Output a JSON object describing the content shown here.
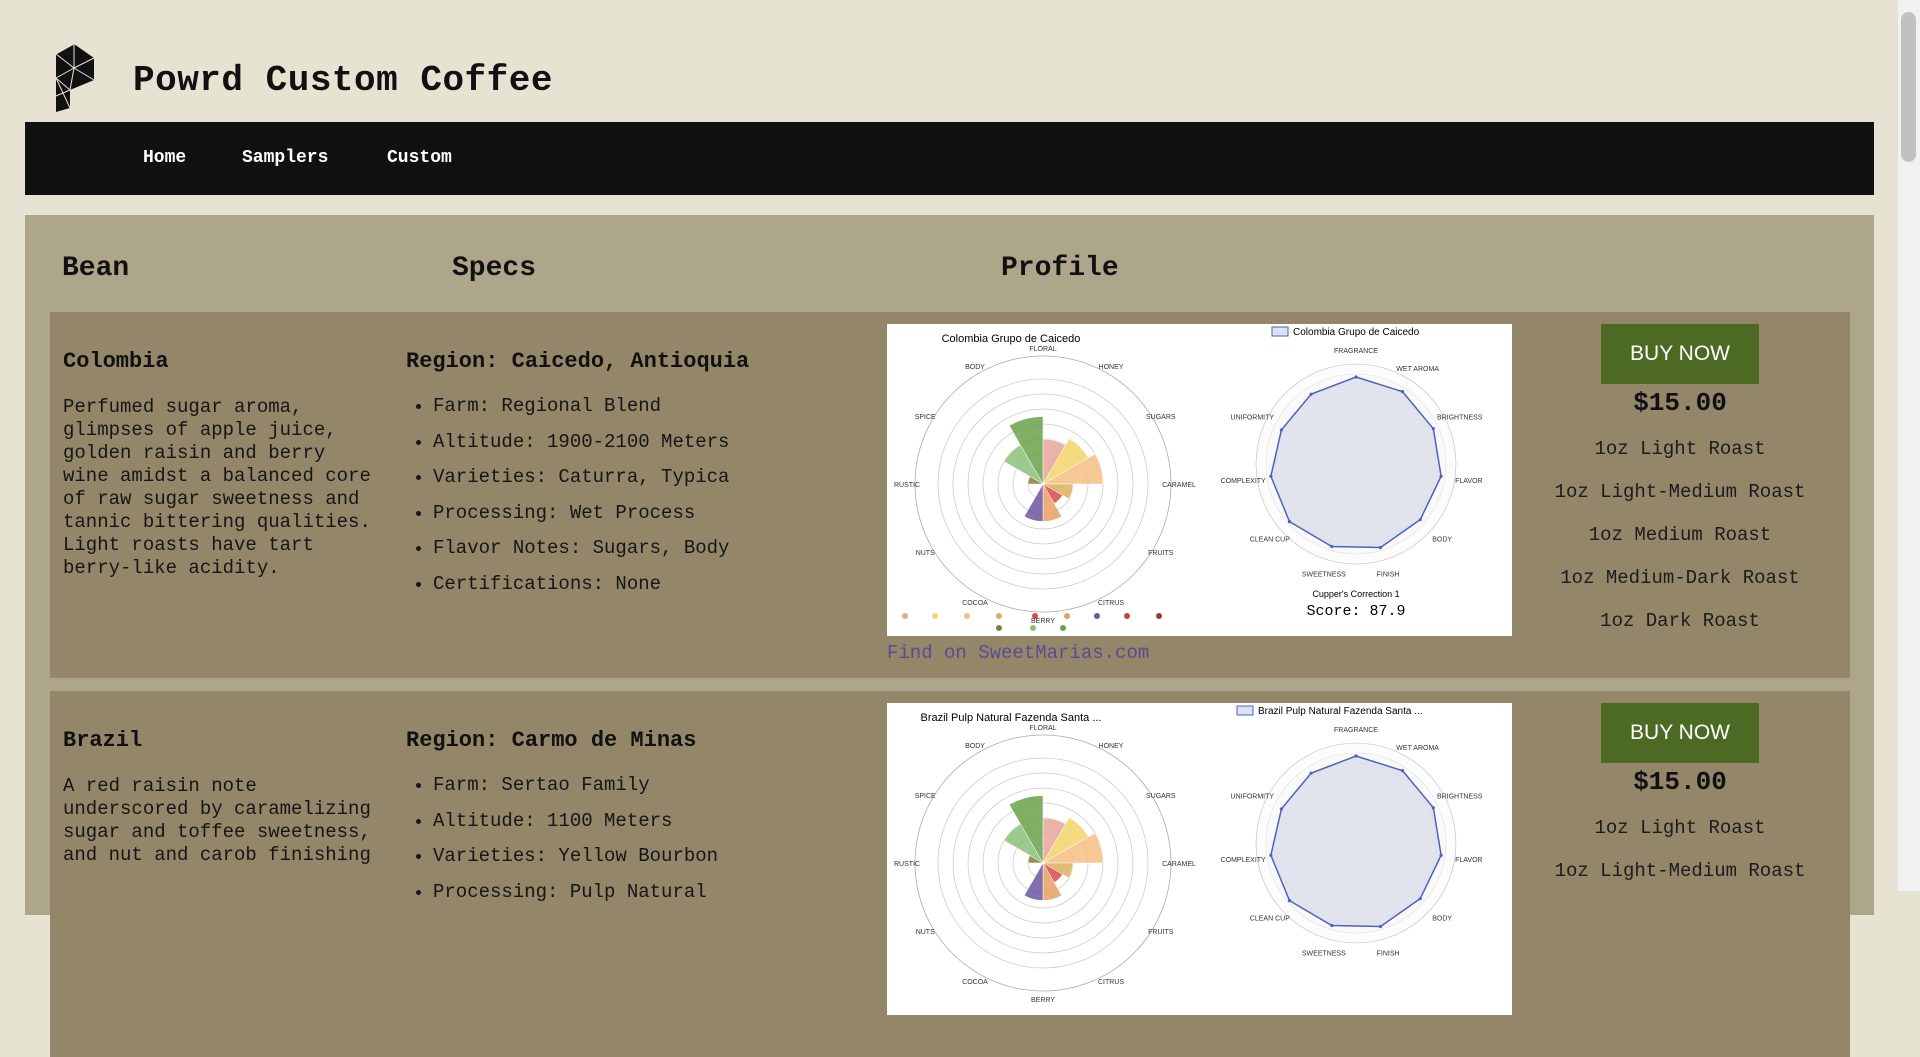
{
  "site": {
    "title": "Powrd Custom Coffee"
  },
  "nav": {
    "items": [
      "Home",
      "Samplers",
      "Custom"
    ]
  },
  "columns": {
    "bean": "Bean",
    "specs": "Specs",
    "profile": "Profile"
  },
  "products": [
    {
      "bean": "Colombia",
      "description": "Perfumed sugar aroma, glimpses of apple juice, golden raisin and berry wine amidst a balanced core of raw sugar sweetness and tannic bittering qualities. Light roasts have tart berry-like acidity.",
      "region": "Region: Caicedo, Antioquia",
      "specs": [
        "Farm: Regional Blend",
        "Altitude: 1900-2100 Meters",
        "Varieties: Caturra, Typica",
        "Processing: Wet Process",
        "Flavor Notes: Sugars, Body",
        "Certifications: None"
      ],
      "flavor_chart_title": "Colombia Grupo de Caicedo",
      "radar_legend": "Colombia Grupo de Caicedo",
      "cupper_label": "Cupper's Correction 1",
      "score": "Score: 87.9",
      "link": "Find on SweetMarias.com",
      "buy": "BUY NOW",
      "price": "$15.00",
      "options": [
        "1oz Light Roast",
        "1oz Light-Medium Roast",
        "1oz Medium Roast",
        "1oz Medium-Dark Roast",
        "1oz Dark Roast"
      ]
    },
    {
      "bean": "Brazil",
      "description": "A red raisin note underscored by caramelizing sugar and toffee sweetness, and nut and carob finishing",
      "region": "Region: Carmo de Minas",
      "specs": [
        "Farm: Sertao Family",
        "Altitude: 1100 Meters",
        "Varieties: Yellow Bourbon",
        "Processing: Pulp Natural"
      ],
      "flavor_chart_title": "Brazil Pulp Natural Fazenda Santa ...",
      "radar_legend": "Brazil Pulp Natural Fazenda Santa ...",
      "buy": "BUY NOW",
      "price": "$15.00",
      "options": [
        "1oz Light Roast",
        "1oz Light-Medium Roast"
      ]
    }
  ],
  "chart_data": [
    {
      "type": "polar-area",
      "title": "Colombia Grupo de Caicedo",
      "categories": [
        "Floral",
        "Honey",
        "Sugars",
        "Caramel",
        "Fruits",
        "Citrus",
        "Berry",
        "Cocoa",
        "Nuts",
        "Rustic",
        "Spice",
        "Body"
      ],
      "values": [
        3,
        3.5,
        4,
        2,
        1.5,
        2.5,
        2.5,
        0,
        0,
        1,
        3,
        4.5
      ],
      "colors": [
        "#e8a49b",
        "#f5d36a",
        "#f5be82",
        "#d8b05a",
        "#d94a4a",
        "#e8a060",
        "#6b56a0",
        "#b84a3a",
        "#9a3a3a",
        "#8a7a3a",
        "#8cc07a",
        "#6aa24a"
      ],
      "rlim": [
        0,
        7
      ]
    },
    {
      "type": "radar",
      "series": [
        {
          "name": "Colombia Grupo de Caicedo",
          "values": [
            8.7,
            8.6,
            8.5,
            8.6,
            8.5,
            8.7,
            8.6,
            8.8,
            8.6,
            8.2,
            8.3
          ]
        }
      ],
      "categories": [
        "Fragrance",
        "Wet Aroma",
        "Brightness",
        "Flavor",
        "Body",
        "Finish",
        "Sweetness",
        "Clean Cup",
        "Complexity",
        "Uniformity",
        "Cupper's Correction 1"
      ],
      "rlim": [
        0,
        10
      ]
    }
  ]
}
